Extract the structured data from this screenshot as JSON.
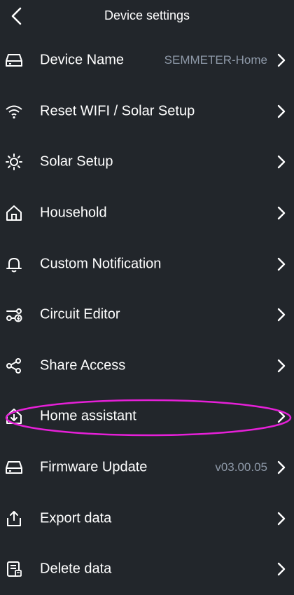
{
  "header": {
    "title": "Device settings"
  },
  "rows": [
    {
      "label": "Device Name",
      "value": "SEMMETER-Home",
      "icon": "device-icon"
    },
    {
      "label": "Reset WIFI / Solar Setup",
      "value": "",
      "icon": "wifi-icon"
    },
    {
      "label": "Solar Setup",
      "value": "",
      "icon": "sun-icon"
    },
    {
      "label": "Household",
      "value": "",
      "icon": "home-icon"
    },
    {
      "label": "Custom Notification",
      "value": "",
      "icon": "bell-icon"
    },
    {
      "label": "Circuit Editor",
      "value": "",
      "icon": "circuit-icon"
    },
    {
      "label": "Share Access",
      "value": "",
      "icon": "share-icon"
    },
    {
      "label": "Home assistant",
      "value": "",
      "icon": "home-download-icon"
    },
    {
      "label": "Firmware Update",
      "value": "v03.00.05",
      "icon": "firmware-icon"
    },
    {
      "label": "Export data",
      "value": "",
      "icon": "export-icon"
    },
    {
      "label": "Delete data",
      "value": "",
      "icon": "delete-data-icon"
    }
  ],
  "colors": {
    "background": "#22262b",
    "text": "#ffffff",
    "secondary": "#8e99a8",
    "highlight": "#e620d8"
  }
}
